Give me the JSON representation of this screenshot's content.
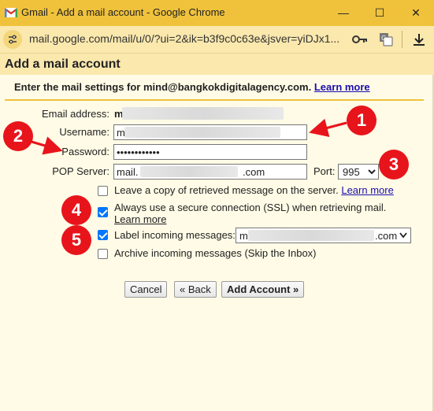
{
  "window": {
    "title": "Gmail - Add a mail account - Google Chrome",
    "minimize": "—",
    "maximize": "☐",
    "close": "✕"
  },
  "addressbar": {
    "url": "mail.google.com/mail/u/0/?ui=2&ik=b3f9c0c63e&jsver=yiDJx1..."
  },
  "dialog": {
    "title": "Add a mail account",
    "intro": "Enter the mail settings for mind@bangkokdigitalagency.com.",
    "intro_link": "Learn more",
    "email_label": "Email address:",
    "email_value_prefix": "m",
    "username_label": "Username:",
    "username_value": "m",
    "password_label": "Password:",
    "password_value": "••••••••••••",
    "pop_label": "POP Server:",
    "pop_value_prefix": "mail.",
    "pop_value_suffix": ".com",
    "port_label": "Port:",
    "port_value": "995",
    "leave_copy_label": "Leave a copy of retrieved message on the server.",
    "leave_copy_link": "Learn more",
    "ssl_label": "Always use a secure connection (SSL) when retrieving mail.",
    "ssl_link": "Learn more",
    "label_incoming_label": "Label incoming messages:",
    "label_value_prefix": "m",
    "label_value_suffix": ".com",
    "archive_label": "Archive incoming messages (Skip the Inbox)",
    "cancel": "Cancel",
    "back": "« Back",
    "add_account": "Add Account »"
  },
  "markers": [
    "1",
    "2",
    "3",
    "4",
    "5"
  ],
  "colors": {
    "titlebar": "#f0c23b",
    "marker": "#e8141b",
    "checkbox": "#0075ff",
    "link": "#1a0dab"
  }
}
